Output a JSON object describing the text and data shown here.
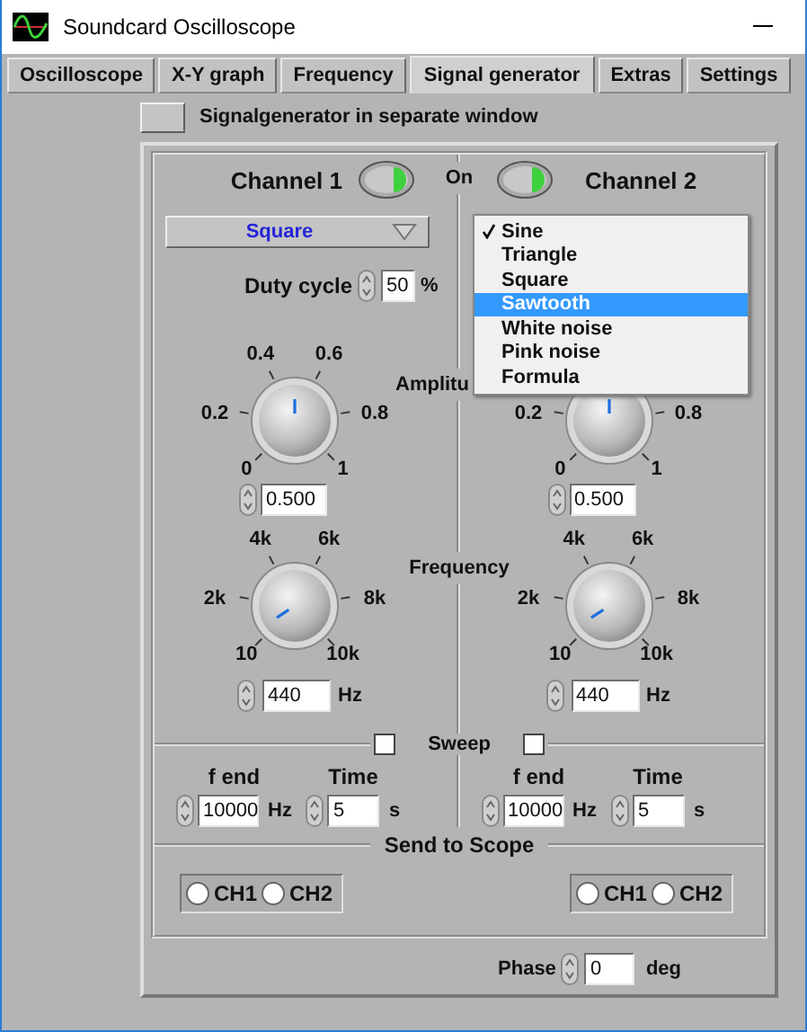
{
  "window": {
    "title": "Soundcard Oscilloscope"
  },
  "tabs": [
    {
      "label": "Oscilloscope",
      "selected": false
    },
    {
      "label": "X-Y graph",
      "selected": false
    },
    {
      "label": "Frequency",
      "selected": false
    },
    {
      "label": "Signal generator",
      "selected": true
    },
    {
      "label": "Extras",
      "selected": false
    },
    {
      "label": "Settings",
      "selected": false
    }
  ],
  "separate_window": {
    "label": "Signalgenerator in separate window",
    "on": false
  },
  "switch_label": "On",
  "amplitude_label": "Amplitu",
  "frequency_label": "Frequency",
  "channels": [
    {
      "name": "Channel 1",
      "on": true,
      "waveform": "Square",
      "duty_cycle": {
        "label": "Duty cycle",
        "value": "50",
        "unit": "%"
      },
      "amplitude": {
        "level": 0.5,
        "value": "0.500",
        "labels": [
          "0",
          "0.2",
          "0.4",
          "0.6",
          "0.8",
          "1"
        ]
      },
      "frequency": {
        "value": "440",
        "unit": "Hz",
        "labels": [
          "10",
          "2k",
          "4k",
          "6k",
          "8k",
          "10k"
        ]
      },
      "sweep": {
        "checked": false,
        "f_end_label": "f end",
        "f_end": "10000",
        "f_end_unit": "Hz",
        "time_label": "Time",
        "time": "5",
        "time_unit": "s"
      },
      "send_to_scope": [
        {
          "label": "CH1",
          "selected": false
        },
        {
          "label": "CH2",
          "selected": false
        }
      ]
    },
    {
      "name": "Channel 2",
      "on": true,
      "amplitude": {
        "level": 0.5,
        "value": "0.500",
        "labels": [
          "0",
          "0.2",
          "0.8",
          "1"
        ]
      },
      "frequency": {
        "value": "440",
        "unit": "Hz",
        "labels": [
          "10",
          "2k",
          "4k",
          "6k",
          "8k",
          "10k"
        ]
      },
      "sweep": {
        "checked": false,
        "f_end_label": "f end",
        "f_end": "10000",
        "f_end_unit": "Hz",
        "time_label": "Time",
        "time": "5",
        "time_unit": "s"
      },
      "send_to_scope": [
        {
          "label": "CH1",
          "selected": false
        },
        {
          "label": "CH2",
          "selected": false
        }
      ]
    }
  ],
  "waveform_menu": {
    "items": [
      {
        "label": "Sine",
        "checked": true,
        "selected": false
      },
      {
        "label": "Triangle",
        "checked": false,
        "selected": false
      },
      {
        "label": "Square",
        "checked": false,
        "selected": false
      },
      {
        "label": "Sawtooth",
        "checked": false,
        "selected": true
      },
      {
        "label": "White noise",
        "checked": false,
        "selected": false
      },
      {
        "label": "Pink noise",
        "checked": false,
        "selected": false
      },
      {
        "label": "Formula",
        "checked": false,
        "selected": false
      }
    ]
  },
  "sweep_label": "Sweep",
  "send_label": "Send to Scope",
  "phase": {
    "label": "Phase",
    "value": "0",
    "unit": "deg"
  }
}
